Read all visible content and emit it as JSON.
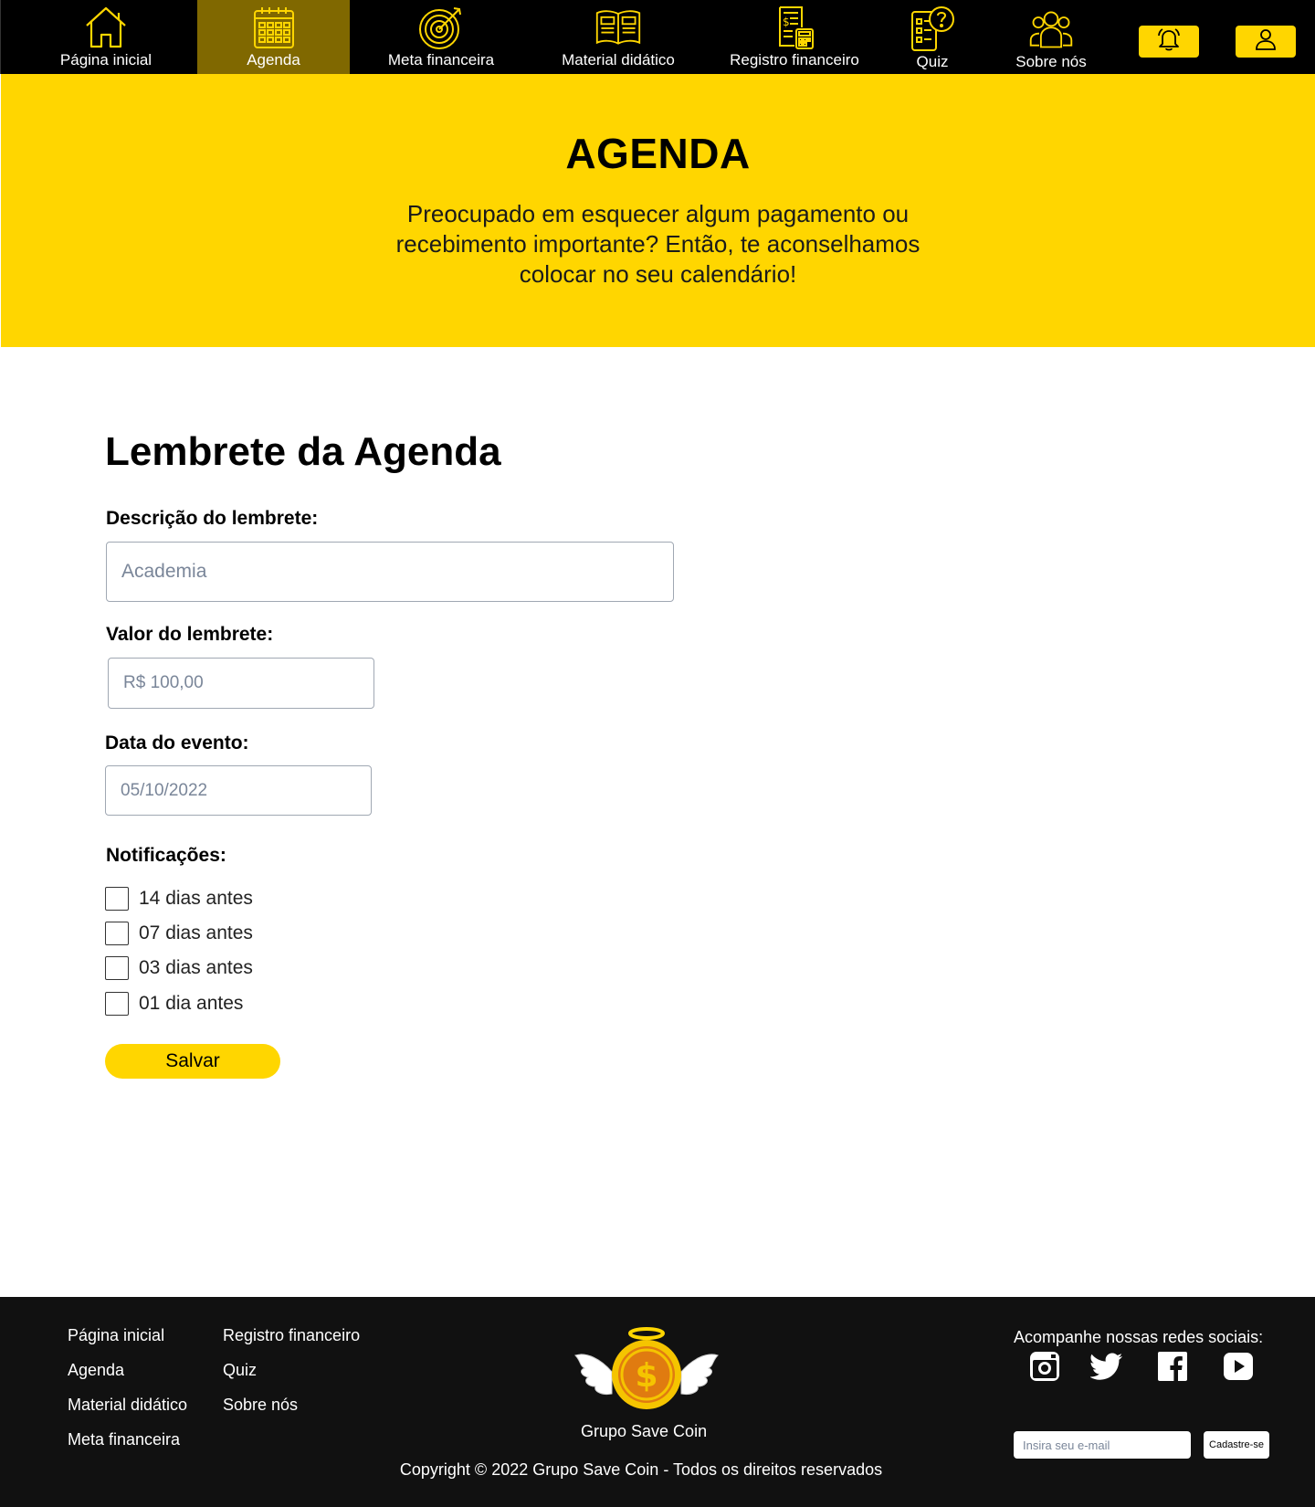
{
  "nav": {
    "items": [
      {
        "label": "Página inicial",
        "icon": "home-icon"
      },
      {
        "label": "Agenda",
        "icon": "calendar-icon",
        "active": true
      },
      {
        "label": "Meta financeira",
        "icon": "target-icon"
      },
      {
        "label": "Material didático",
        "icon": "book-icon"
      },
      {
        "label": "Registro financeiro",
        "icon": "receipt-calculator-icon"
      },
      {
        "label": "Quiz",
        "icon": "quiz-icon"
      },
      {
        "label": "Sobre nós",
        "icon": "group-icon"
      }
    ],
    "notification_icon": "bell-icon",
    "profile_icon": "user-icon"
  },
  "hero": {
    "title": "AGENDA",
    "subtitle": "Preocupado em esquecer algum pagamento ou recebimento importante? Então, te aconselhamos colocar no seu calendário!"
  },
  "form": {
    "title": "Lembrete da Agenda",
    "description_label": "Descrição do lembrete:",
    "description_placeholder": "Academia",
    "value_label": "Valor do lembrete:",
    "value_placeholder": "R$ 100,00",
    "date_label": "Data do evento:",
    "date_placeholder": "05/10/2022",
    "notifications_label": "Notificações:",
    "notifications": [
      "14 dias antes",
      "07 dias antes",
      "03 dias antes",
      "01 dia antes"
    ],
    "save_label": "Salvar"
  },
  "footer": {
    "links_col1": [
      "Página inicial",
      "Agenda",
      "Material didático",
      "Meta financeira"
    ],
    "links_col2": [
      "Registro financeiro",
      "Quiz",
      "Sobre nós"
    ],
    "brand": "Grupo Save Coin",
    "copyright": "Copyright © 2022 Grupo Save Coin - Todos os direitos reservados",
    "social_title": "Acompanhe nossas redes sociais:",
    "social_icons": [
      "instagram-icon",
      "twitter-icon",
      "facebook-icon",
      "youtube-icon"
    ],
    "email_placeholder": "Insira seu e-mail",
    "signup_label": "Cadastre-se"
  },
  "colors": {
    "accent": "#ffd600",
    "active_nav": "#806800",
    "nav_bg": "#000000",
    "footer_bg": "#111111"
  }
}
